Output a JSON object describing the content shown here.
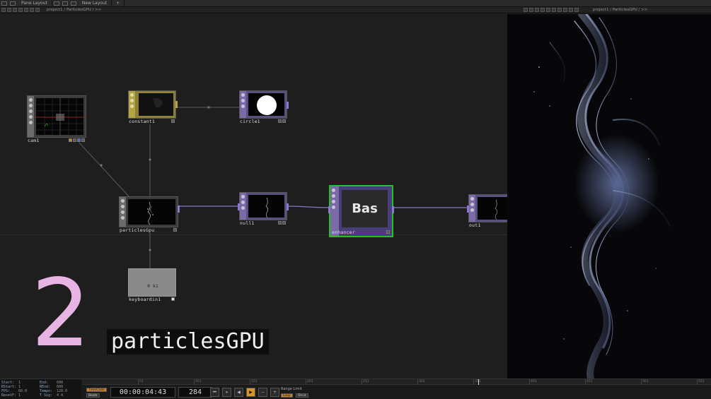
{
  "topbar": {
    "tabs": [
      "Pane Layout",
      "New Layout"
    ],
    "add_tab": "+"
  },
  "path": {
    "left": "project1 / ParticlesGPU / >>",
    "right": "project1 / ParticlesGPU / >>"
  },
  "nodes": {
    "cam1": "cam1",
    "constant1": "constant1",
    "circle1": "circle1",
    "particlesGpu": "particlesGpu",
    "null1": "null1",
    "enhancer": "enhancer",
    "enhancer_preview_text": "Bas",
    "out1": "out1",
    "keyboardin1": "keyboardin1",
    "keyboardin1_value": "0 k1"
  },
  "overlay": {
    "number": "2",
    "title": "particlesGPU"
  },
  "timeline": {
    "info": {
      "start_label": "Start:",
      "start_value": "1",
      "end_label": "End:",
      "end_value": "600",
      "rstart_label": "RStart:",
      "rstart_value": "1",
      "rend_label": "REnd:",
      "rend_value": "600",
      "fps_label": "FPS:",
      "fps_value": "60.0",
      "tempo_label": "Tempo:",
      "tempo_value": "120.0",
      "resetf_label": "ResetF:",
      "resetf_value": "1",
      "tsig_label": "T Sig:",
      "tsig_value": "4   4"
    },
    "timecode_button": "TimeCode",
    "beats_button": "Beats",
    "timecode": "00:00:04:43",
    "frame": "284",
    "range_limit": "Range Limit",
    "loop_button": "Loop",
    "once_button": "Once",
    "ruler_ticks": [
      "51",
      "101",
      "151",
      "201",
      "251",
      "301",
      "351",
      "401",
      "451",
      "501",
      "551",
      "601"
    ]
  },
  "colors": {
    "selected_outline": "#1ec41e",
    "top_family": "#7a6aa6",
    "chop_family": "#b4a544",
    "overlay_number": "#e8b4e4",
    "play_active": "#d9952a"
  }
}
